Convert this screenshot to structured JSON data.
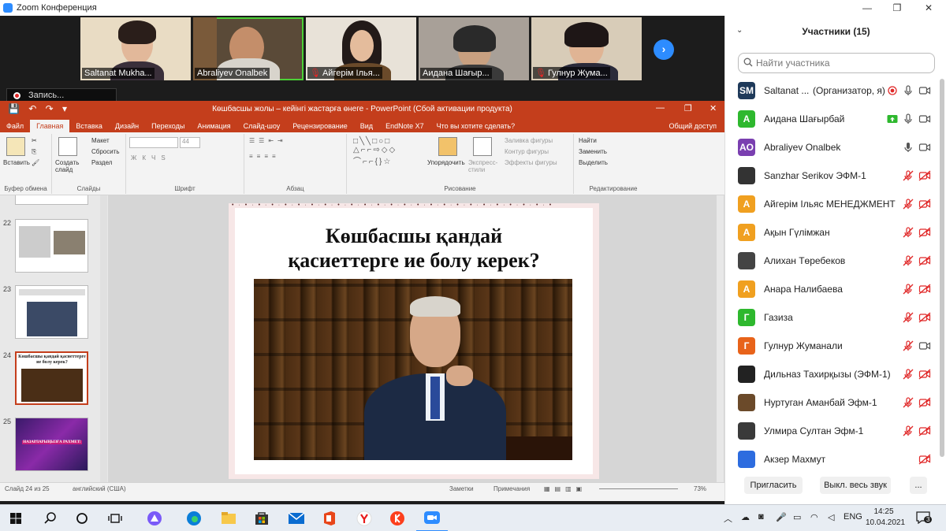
{
  "window": {
    "title": "Zoom Конференция"
  },
  "videos": [
    {
      "name": "Saltanat Mukha...",
      "muted": false
    },
    {
      "name": "Abraliyev Onalbek",
      "muted": false,
      "active": true
    },
    {
      "name": "Айгерім Ілья...",
      "muted": true
    },
    {
      "name": "Аидана Шағыр...",
      "muted": false
    },
    {
      "name": "Гулнур Жума...",
      "muted": true
    }
  ],
  "recording": {
    "label": "Запись..."
  },
  "powerpoint": {
    "doc_title": "Көшбасшы жолы – кейінгі жастарға өнеге - PowerPoint (Сбой активации продукта)",
    "tabs": [
      "Файл",
      "Главная",
      "Вставка",
      "Дизайн",
      "Переходы",
      "Анимация",
      "Слайд-шоу",
      "Рецензирование",
      "Вид",
      "EndNote X7",
      "Что вы хотите сделать?"
    ],
    "share": "Общий доступ",
    "ribbon": {
      "paste": "Вставить",
      "clipboard": "Буфер обмена",
      "new_slide": "Создать слайд",
      "layout": "Макет",
      "reset": "Сбросить",
      "section": "Раздел",
      "slides_group": "Слайды",
      "font_size": "44",
      "font_group": "Шрифт",
      "paragraph_group": "Абзац",
      "arrange": "Упорядочить",
      "quick_styles": "Экспресс-стили",
      "shape_fill": "Заливка фигуры",
      "shape_outline": "Контур фигуры",
      "shape_effects": "Эффекты фигуры",
      "drawing_group": "Рисование",
      "find": "Найти",
      "replace": "Заменить",
      "select": "Выделить",
      "editing_group": "Редактирование"
    },
    "thumbnails": [
      {
        "num": "22"
      },
      {
        "num": "23"
      },
      {
        "num": "24",
        "caption": "Көшбасшы қандай қасиеттерге ие болу керек?"
      },
      {
        "num": "25",
        "caption": "НАЗАРЛАРЫҢЫЗҒА РАХМЕТ!"
      }
    ],
    "slide": {
      "title_line1": "Көшбасшы қандай",
      "title_line2": "қасиеттерге ие болу керек?"
    },
    "status": {
      "slide_info": "Слайд 24 из 25",
      "language": "английский (США)",
      "notes": "Заметки",
      "comments": "Примечания",
      "zoom": "73%"
    }
  },
  "participants": {
    "header": "Участники (15)",
    "search_placeholder": "Найти участника",
    "list": [
      {
        "initials": "SM",
        "color": "#1f3a5a",
        "name": "Saltanat ...",
        "role": "(Организатор, я)"
      },
      {
        "initials": "А",
        "color": "#2eb82e",
        "name": "Аидана Шағырбай"
      },
      {
        "initials": "AO",
        "color": "#7a3fb0",
        "name": "Abraliyev Onalbek"
      },
      {
        "initials": "",
        "color": "#333333",
        "name": "Sanzhar Serikov ЭФМ-1"
      },
      {
        "initials": "А",
        "color": "#f0a020",
        "name": "Айгерім Ільяс МЕНЕДЖМЕНТ"
      },
      {
        "initials": "А",
        "color": "#f0a020",
        "name": "Ақын Гүлімжан"
      },
      {
        "initials": "",
        "color": "#444444",
        "name": "Алихан Төребеков"
      },
      {
        "initials": "А",
        "color": "#f0a020",
        "name": "Анара Налибаева"
      },
      {
        "initials": "Г",
        "color": "#2eb82e",
        "name": "Газиза"
      },
      {
        "initials": "Г",
        "color": "#e8631a",
        "name": "Гулнур Жуманали"
      },
      {
        "initials": "",
        "color": "#222222",
        "name": "Дильназ Тахирқызы (ЭФМ-1)"
      },
      {
        "initials": "",
        "color": "#6b4a2a",
        "name": "Нуртуган Аманбай Эфм-1"
      },
      {
        "initials": "",
        "color": "#3a3a3a",
        "name": "Улмира Султан Эфм-1"
      },
      {
        "initials": "",
        "color": "#2d6cdf",
        "name": "Акзер Махмут"
      }
    ],
    "invite": "Пригласить",
    "mute_all": "Выкл. весь звук",
    "more": "..."
  },
  "taskbar": {
    "lang": "ENG",
    "time": "14:25",
    "date": "10.04.2021",
    "notifications": "3"
  }
}
